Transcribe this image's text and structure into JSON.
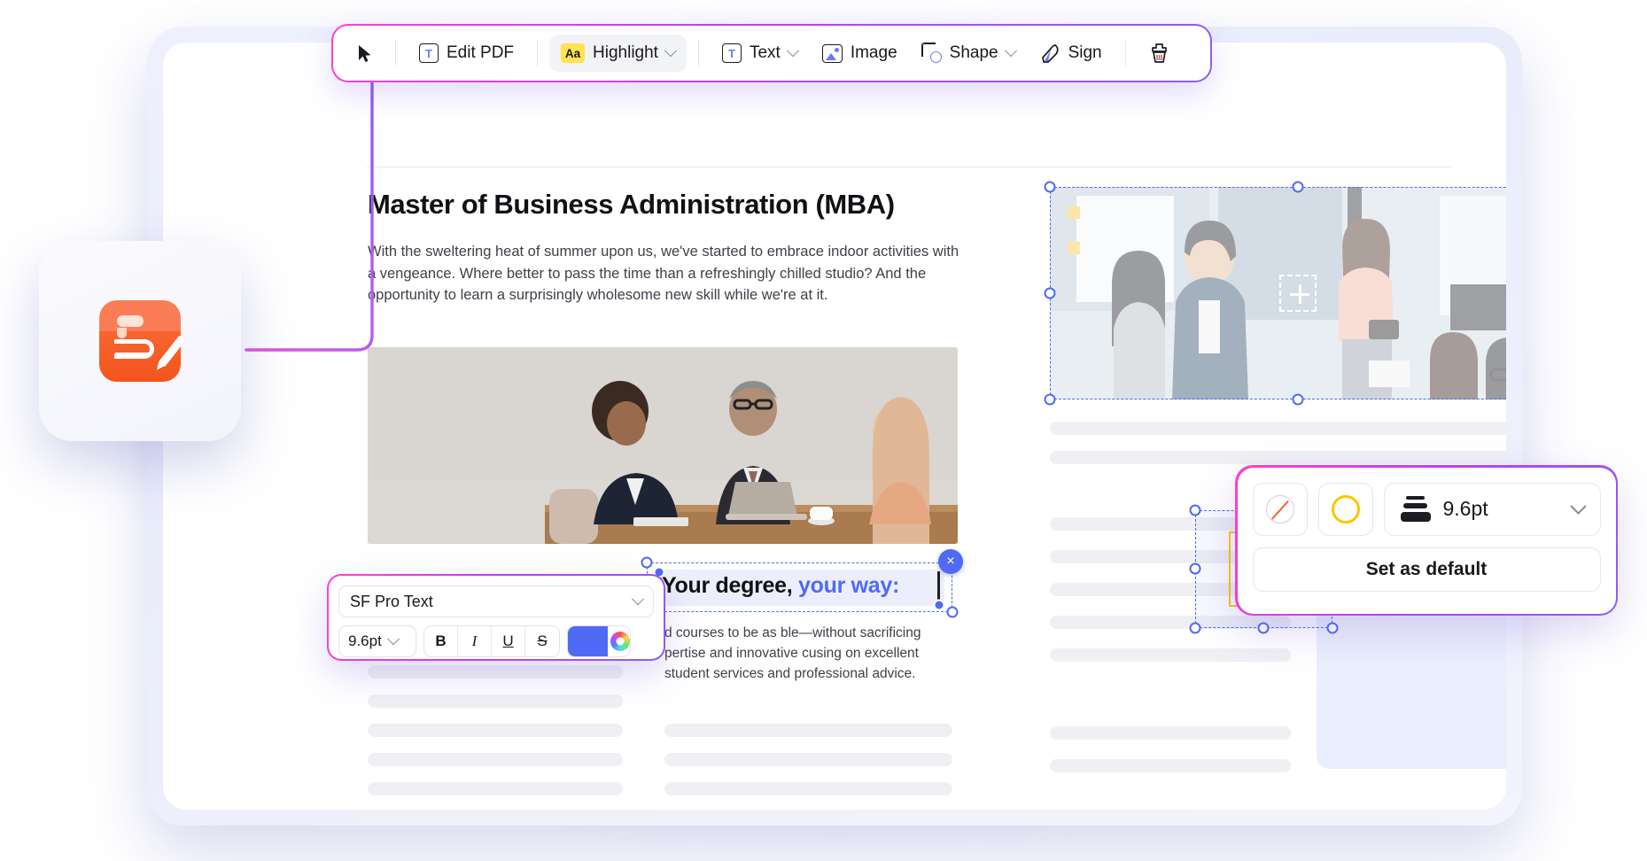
{
  "toolbar": {
    "items": [
      {
        "id": "cursor",
        "label": "",
        "icon": "cursor-arrow-icon",
        "has_caret": false,
        "active": false
      },
      {
        "id": "edit-pdf",
        "label": "Edit PDF",
        "icon": "text-box-icon",
        "has_caret": false,
        "active": false
      },
      {
        "id": "highlight",
        "label": "Highlight",
        "icon": "highlight-aa-icon",
        "has_caret": true,
        "active": true,
        "badge": "Aa"
      },
      {
        "id": "text",
        "label": "Text",
        "icon": "text-box-icon",
        "has_caret": true,
        "active": false
      },
      {
        "id": "image",
        "label": "Image",
        "icon": "image-icon",
        "has_caret": false,
        "active": false
      },
      {
        "id": "shape",
        "label": "Shape",
        "icon": "shape-icon",
        "has_caret": true,
        "active": false
      },
      {
        "id": "sign",
        "label": "Sign",
        "icon": "pen-nib-icon",
        "has_caret": false,
        "active": false
      },
      {
        "id": "eraser",
        "label": "",
        "icon": "eraser-brush-icon",
        "has_caret": false,
        "active": false
      }
    ],
    "accent_gradient": [
      "#ff3fd0",
      "#c23ef2",
      "#8b5cf6"
    ],
    "highlight_badge_color": "#ffe34f"
  },
  "document": {
    "title": "Master of Business Administration (MBA)",
    "paragraph": "With the sweltering heat of summer upon us, we've started to embrace indoor activities with a vengeance. Where better to pass the time than a refreshingly chilled studio? And the opportunity to learn a surprisingly wholesome new skill while we're at it.",
    "right_column_text": "d courses to be as ble—without sacrificing pertise and innovative cusing on excellent student services and professional advice.",
    "photo_left_alt": "three-people-business-meeting-photo",
    "photo_right_alt": "students-group-discussion-photo"
  },
  "text_selection": {
    "text_black": "Your degree,",
    "text_blue": " your way:",
    "blue_color": "#4f6bf6",
    "close_label": "×"
  },
  "font_popover": {
    "font_family": "SF Pro Text",
    "font_size": "9.6pt",
    "styles": [
      {
        "id": "bold",
        "label": "B"
      },
      {
        "id": "italic",
        "label": "I"
      },
      {
        "id": "underline",
        "label": "U"
      },
      {
        "id": "strikethrough",
        "label": "S"
      }
    ],
    "text_color": "#4f6bf6",
    "chevron": "⌄"
  },
  "shape_popover": {
    "fill_label": "no-fill",
    "stroke_color_label": "yellow-stroke",
    "stroke_color": "#fdc500",
    "stroke_width": "9.6pt",
    "set_default_label": "Set as default"
  },
  "shape_selection": {
    "stroke_color": "#fdc500",
    "close_label": "×"
  },
  "app_card": {
    "icon_name": "pdf-sign-app-icon",
    "icon_color": "#f3541e"
  }
}
